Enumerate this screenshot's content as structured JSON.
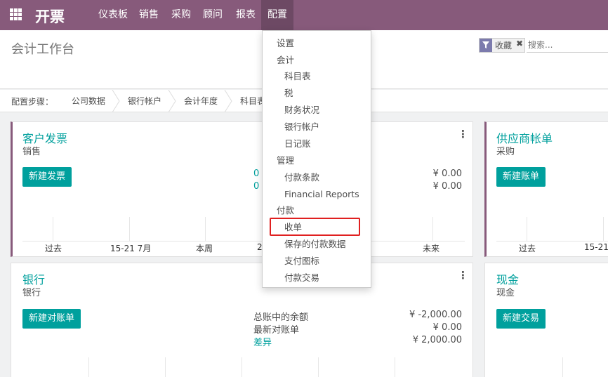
{
  "navbar": {
    "brand": "开票",
    "menu": [
      "仪表板",
      "销售",
      "采购",
      "顾问",
      "报表",
      "配置"
    ],
    "active_menu": "配置",
    "color": "#875a7b"
  },
  "control_panel": {
    "title": "会计工作台",
    "facet_label": "收藏",
    "search_placeholder": "搜索..."
  },
  "setup_bar": {
    "label": "配置步骤：",
    "steps": [
      "公司数据",
      "银行帐户",
      "会计年度",
      "科目表"
    ]
  },
  "cards": {
    "customer_invoices": {
      "title": "客户发票",
      "subtitle": "销售",
      "button": "新建发票",
      "counts": [
        "0",
        "0"
      ],
      "amounts": [
        "¥ 0.00",
        "¥ 0.00"
      ],
      "graph_labels": [
        "过去",
        "15-21 7月",
        "本周",
        "2",
        "未来"
      ]
    },
    "vendor_bills": {
      "title": "供应商帐单",
      "subtitle": "采购",
      "button": "新建账单",
      "graph_labels": [
        "过去",
        "15-21"
      ]
    },
    "bank": {
      "title": "银行",
      "subtitle": "银行",
      "button": "新建对账单",
      "stats": [
        {
          "label": "总账中的余额",
          "value": "¥ -2,000.00"
        },
        {
          "label": "最新对账单",
          "value": "¥ 0.00"
        },
        {
          "label": "差异",
          "value": "¥ 2,000.00"
        }
      ]
    },
    "cash": {
      "title": "现金",
      "subtitle": "现金",
      "button": "新建交易"
    }
  },
  "dropdown": {
    "items": [
      {
        "label": "设置",
        "level": 0
      },
      {
        "label": "会计",
        "level": 0
      },
      {
        "label": "科目表",
        "level": 1
      },
      {
        "label": "税",
        "level": 1
      },
      {
        "label": "财务状况",
        "level": 1
      },
      {
        "label": "银行帐户",
        "level": 1
      },
      {
        "label": "日记账",
        "level": 1
      },
      {
        "label": "管理",
        "level": 0
      },
      {
        "label": "付款条款",
        "level": 1
      },
      {
        "label": "Financial Reports",
        "level": 1
      },
      {
        "label": "付款",
        "level": 0
      },
      {
        "label": "收单",
        "level": 1
      },
      {
        "label": "保存的付款数据",
        "level": 1
      },
      {
        "label": "支付图标",
        "level": 1
      },
      {
        "label": "付款交易",
        "level": 1
      }
    ],
    "highlighted": "收单",
    "highlight_color": "#e02020"
  }
}
